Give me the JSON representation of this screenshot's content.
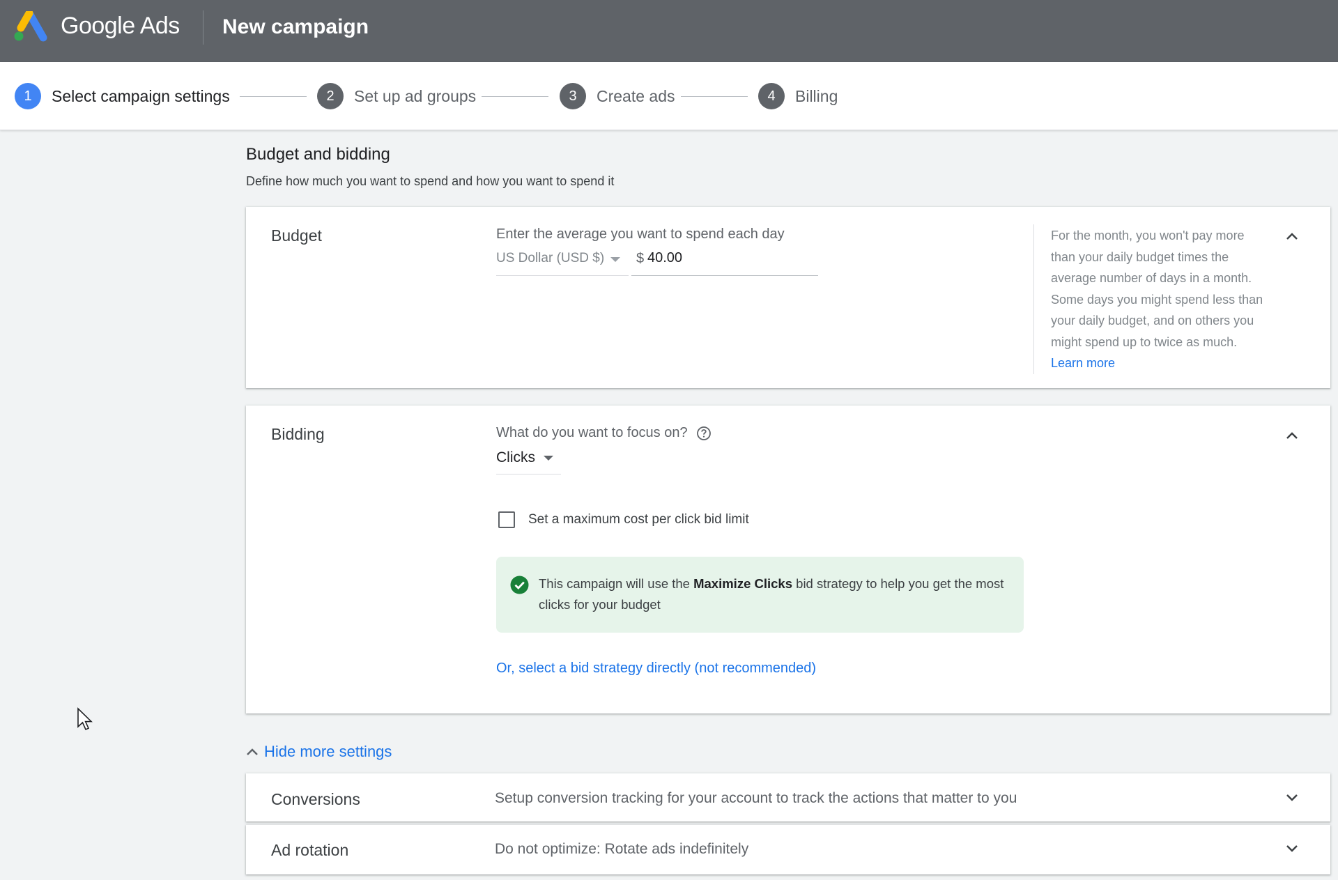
{
  "header": {
    "app_name": "Google Ads",
    "page_title": "New campaign"
  },
  "stepper": {
    "steps": [
      {
        "number": "1",
        "label": "Select campaign settings",
        "active": true
      },
      {
        "number": "2",
        "label": "Set up ad groups",
        "active": false
      },
      {
        "number": "3",
        "label": "Create ads",
        "active": false
      },
      {
        "number": "4",
        "label": "Billing",
        "active": false
      }
    ]
  },
  "section": {
    "title": "Budget and bidding",
    "subtitle": "Define how much you want to spend and how you want to spend it"
  },
  "budget": {
    "label": "Budget",
    "prompt": "Enter the average you want to spend each day",
    "currency": "US Dollar (USD $)",
    "currency_symbol": "$",
    "amount": "40.00",
    "help_text": "For the month, you won't pay more than your daily budget times the average number of days in a month. Some days you might spend less than your daily budget, and on others you might spend up to twice as much.",
    "learn_more": "Learn more"
  },
  "bidding": {
    "label": "Bidding",
    "question": "What do you want to focus on?",
    "focus": "Clicks",
    "checkbox_label": "Set a maximum cost per click bid limit",
    "checkbox_checked": false,
    "info_prefix": "This campaign will use the ",
    "info_strategy": "Maximize Clicks",
    "info_suffix": " bid strategy to help you get the most clicks for your budget",
    "select_strategy_link": "Or, select a bid strategy directly (not recommended)"
  },
  "more_settings": {
    "toggle_label": "Hide more settings",
    "rows": [
      {
        "label": "Conversions",
        "value": "Setup conversion tracking for your account to track the actions that matter to you"
      },
      {
        "label": "Ad rotation",
        "value": "Do not optimize: Rotate ads indefinitely"
      }
    ]
  },
  "icons": {
    "collapse": "chevron-up-icon",
    "expand": "chevron-down-icon",
    "help": "help-circle-icon",
    "check": "check-circle-icon"
  },
  "colors": {
    "header_bg": "#5f6368",
    "accent": "#1a73e8",
    "active_step": "#4285f4",
    "success": "#188038",
    "info_bg": "#e6f4ea"
  }
}
